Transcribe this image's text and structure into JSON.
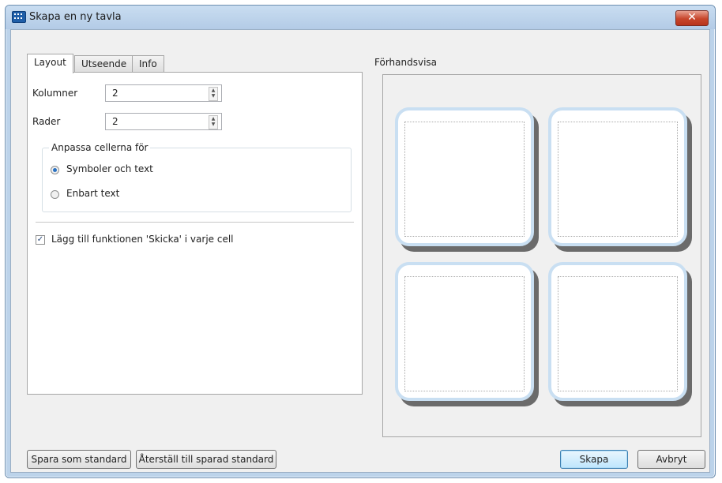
{
  "window": {
    "title": "Skapa en ny tavla",
    "close_symbol": "✕"
  },
  "tabs": [
    {
      "label": "Layout",
      "active": true
    },
    {
      "label": "Utseende",
      "active": false
    },
    {
      "label": "Info",
      "active": false
    }
  ],
  "layout": {
    "columns": {
      "label": "Kolumner",
      "value": "2"
    },
    "rows": {
      "label": "Rader",
      "value": "2"
    },
    "adapt_group": {
      "title": "Anpassa cellerna för",
      "options": [
        {
          "label": "Symboler och text",
          "selected": true
        },
        {
          "label": "Enbart text",
          "selected": false
        }
      ]
    },
    "send_checkbox": {
      "label": "Lägg till funktionen 'Skicka' i varje cell",
      "checked": true
    }
  },
  "preview": {
    "label": "Förhandsvisa",
    "grid_columns": 2,
    "grid_rows": 2
  },
  "buttons": {
    "save_default": "Spara som standard",
    "restore_default": "Återställ till sparad standard",
    "create": "Skapa",
    "cancel": "Avbryt"
  },
  "colors": {
    "accent": "#2a72c2",
    "close": "#c7452b",
    "cell_border": "#c9dff2"
  }
}
